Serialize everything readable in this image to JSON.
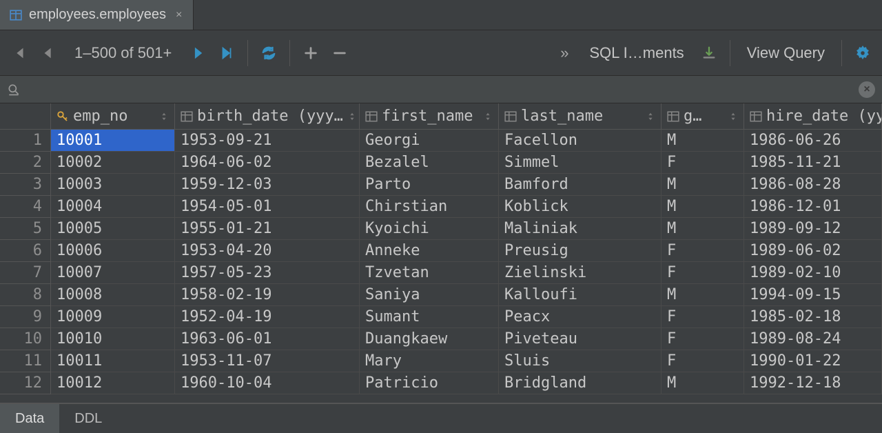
{
  "tab": {
    "title": "employees.employees"
  },
  "toolbar": {
    "range": "1–500 of 501+",
    "sql": "SQL I…ments",
    "viewQuery": "View Query"
  },
  "columns": [
    {
      "label": "emp_no",
      "key": true,
      "width": "c-emp"
    },
    {
      "label": "birth_date (yyy…",
      "key": false,
      "width": "c-birth"
    },
    {
      "label": "first_name",
      "key": false,
      "width": "c-first"
    },
    {
      "label": "last_name",
      "key": false,
      "width": "c-last"
    },
    {
      "label": "g…",
      "key": false,
      "width": "c-gender"
    },
    {
      "label": "hire_date (yy",
      "key": false,
      "width": "c-hire"
    }
  ],
  "rows": [
    {
      "n": "1",
      "emp_no": "10001",
      "birth_date": "1953-09-21",
      "first_name": "Georgi",
      "last_name": "Facellon",
      "gender": "M",
      "hire_date": "1986-06-26"
    },
    {
      "n": "2",
      "emp_no": "10002",
      "birth_date": "1964-06-02",
      "first_name": "Bezalel",
      "last_name": "Simmel",
      "gender": "F",
      "hire_date": "1985-11-21"
    },
    {
      "n": "3",
      "emp_no": "10003",
      "birth_date": "1959-12-03",
      "first_name": "Parto",
      "last_name": "Bamford",
      "gender": "M",
      "hire_date": "1986-08-28"
    },
    {
      "n": "4",
      "emp_no": "10004",
      "birth_date": "1954-05-01",
      "first_name": "Chirstian",
      "last_name": "Koblick",
      "gender": "M",
      "hire_date": "1986-12-01"
    },
    {
      "n": "5",
      "emp_no": "10005",
      "birth_date": "1955-01-21",
      "first_name": "Kyoichi",
      "last_name": "Maliniak",
      "gender": "M",
      "hire_date": "1989-09-12"
    },
    {
      "n": "6",
      "emp_no": "10006",
      "birth_date": "1953-04-20",
      "first_name": "Anneke",
      "last_name": "Preusig",
      "gender": "F",
      "hire_date": "1989-06-02"
    },
    {
      "n": "7",
      "emp_no": "10007",
      "birth_date": "1957-05-23",
      "first_name": "Tzvetan",
      "last_name": "Zielinski",
      "gender": "F",
      "hire_date": "1989-02-10"
    },
    {
      "n": "8",
      "emp_no": "10008",
      "birth_date": "1958-02-19",
      "first_name": "Saniya",
      "last_name": "Kalloufi",
      "gender": "M",
      "hire_date": "1994-09-15"
    },
    {
      "n": "9",
      "emp_no": "10009",
      "birth_date": "1952-04-19",
      "first_name": "Sumant",
      "last_name": "Peacx",
      "gender": "F",
      "hire_date": "1985-02-18"
    },
    {
      "n": "10",
      "emp_no": "10010",
      "birth_date": "1963-06-01",
      "first_name": "Duangkaew",
      "last_name": "Piveteau",
      "gender": "F",
      "hire_date": "1989-08-24"
    },
    {
      "n": "11",
      "emp_no": "10011",
      "birth_date": "1953-11-07",
      "first_name": "Mary",
      "last_name": "Sluis",
      "gender": "F",
      "hire_date": "1990-01-22"
    },
    {
      "n": "12",
      "emp_no": "10012",
      "birth_date": "1960-10-04",
      "first_name": "Patricio",
      "last_name": "Bridgland",
      "gender": "M",
      "hire_date": "1992-12-18"
    }
  ],
  "bottomTabs": {
    "data": "Data",
    "ddl": "DDL"
  },
  "selected": {
    "row": 0,
    "col": "emp_no"
  }
}
